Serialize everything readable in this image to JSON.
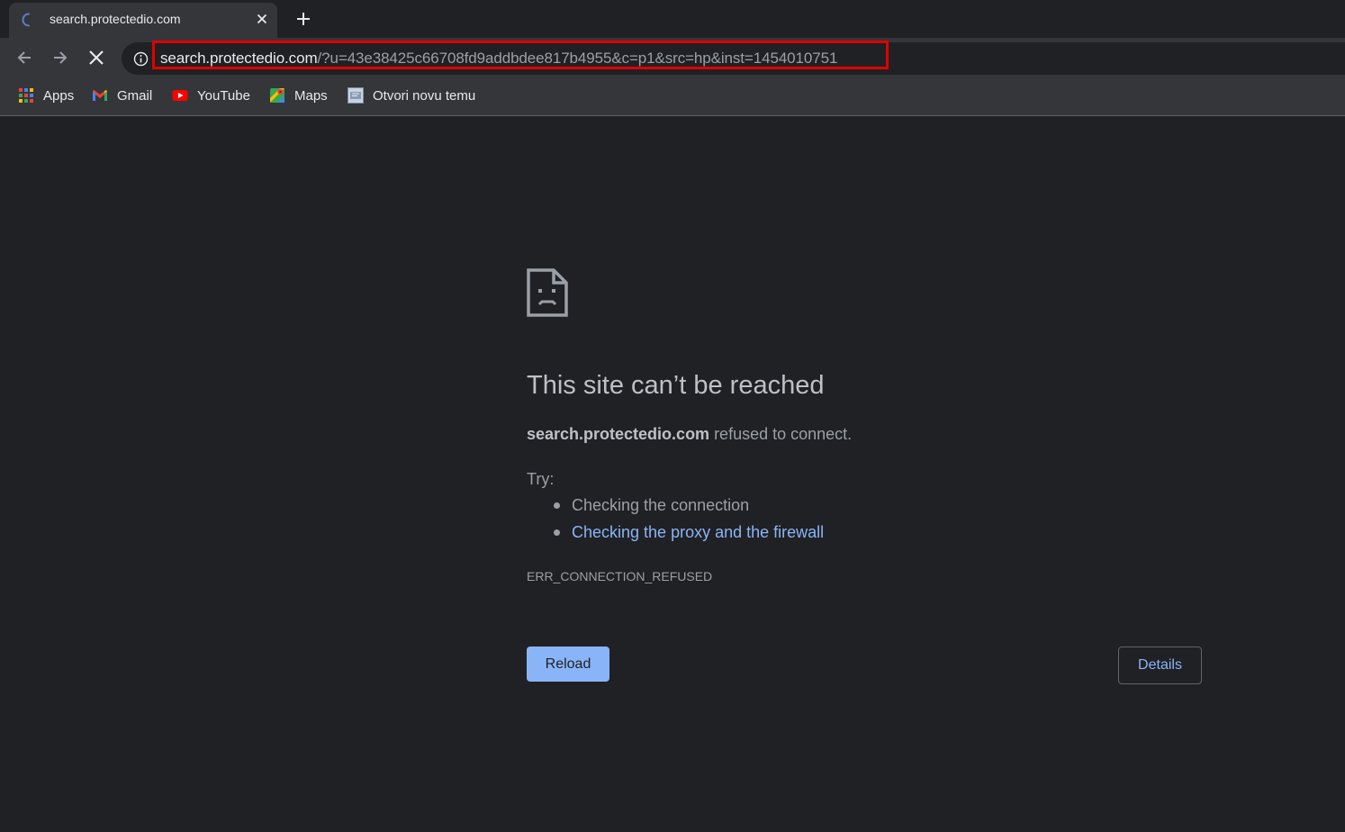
{
  "tab": {
    "title": "search.protectedio.com",
    "loading": true
  },
  "toolbar": {
    "url_host": "search.protectedio.com",
    "url_path": "/?u=43e38425c66708fd9addbdee817b4955&c=p1&src=hp&inst=1454010751"
  },
  "bookmarks": [
    {
      "label": "Apps",
      "icon": "apps-grid-icon"
    },
    {
      "label": "Gmail",
      "icon": "gmail-icon"
    },
    {
      "label": "YouTube",
      "icon": "youtube-icon"
    },
    {
      "label": "Maps",
      "icon": "maps-icon"
    },
    {
      "label": "Otvori novu temu",
      "icon": "forum-favicon-icon"
    }
  ],
  "error": {
    "title": "This site can’t be reached",
    "host": "search.protectedio.com",
    "message": " refused to connect.",
    "try_label": "Try:",
    "suggestions": [
      {
        "text": "Checking the connection",
        "link": false
      },
      {
        "text": "Checking the proxy and the firewall",
        "link": true
      }
    ],
    "code": "ERR_CONNECTION_REFUSED",
    "reload_label": "Reload",
    "details_label": "Details"
  },
  "colors": {
    "background": "#202124",
    "chrome": "#35363a",
    "highlight": "#e00000",
    "link": "#8ab4f8"
  }
}
